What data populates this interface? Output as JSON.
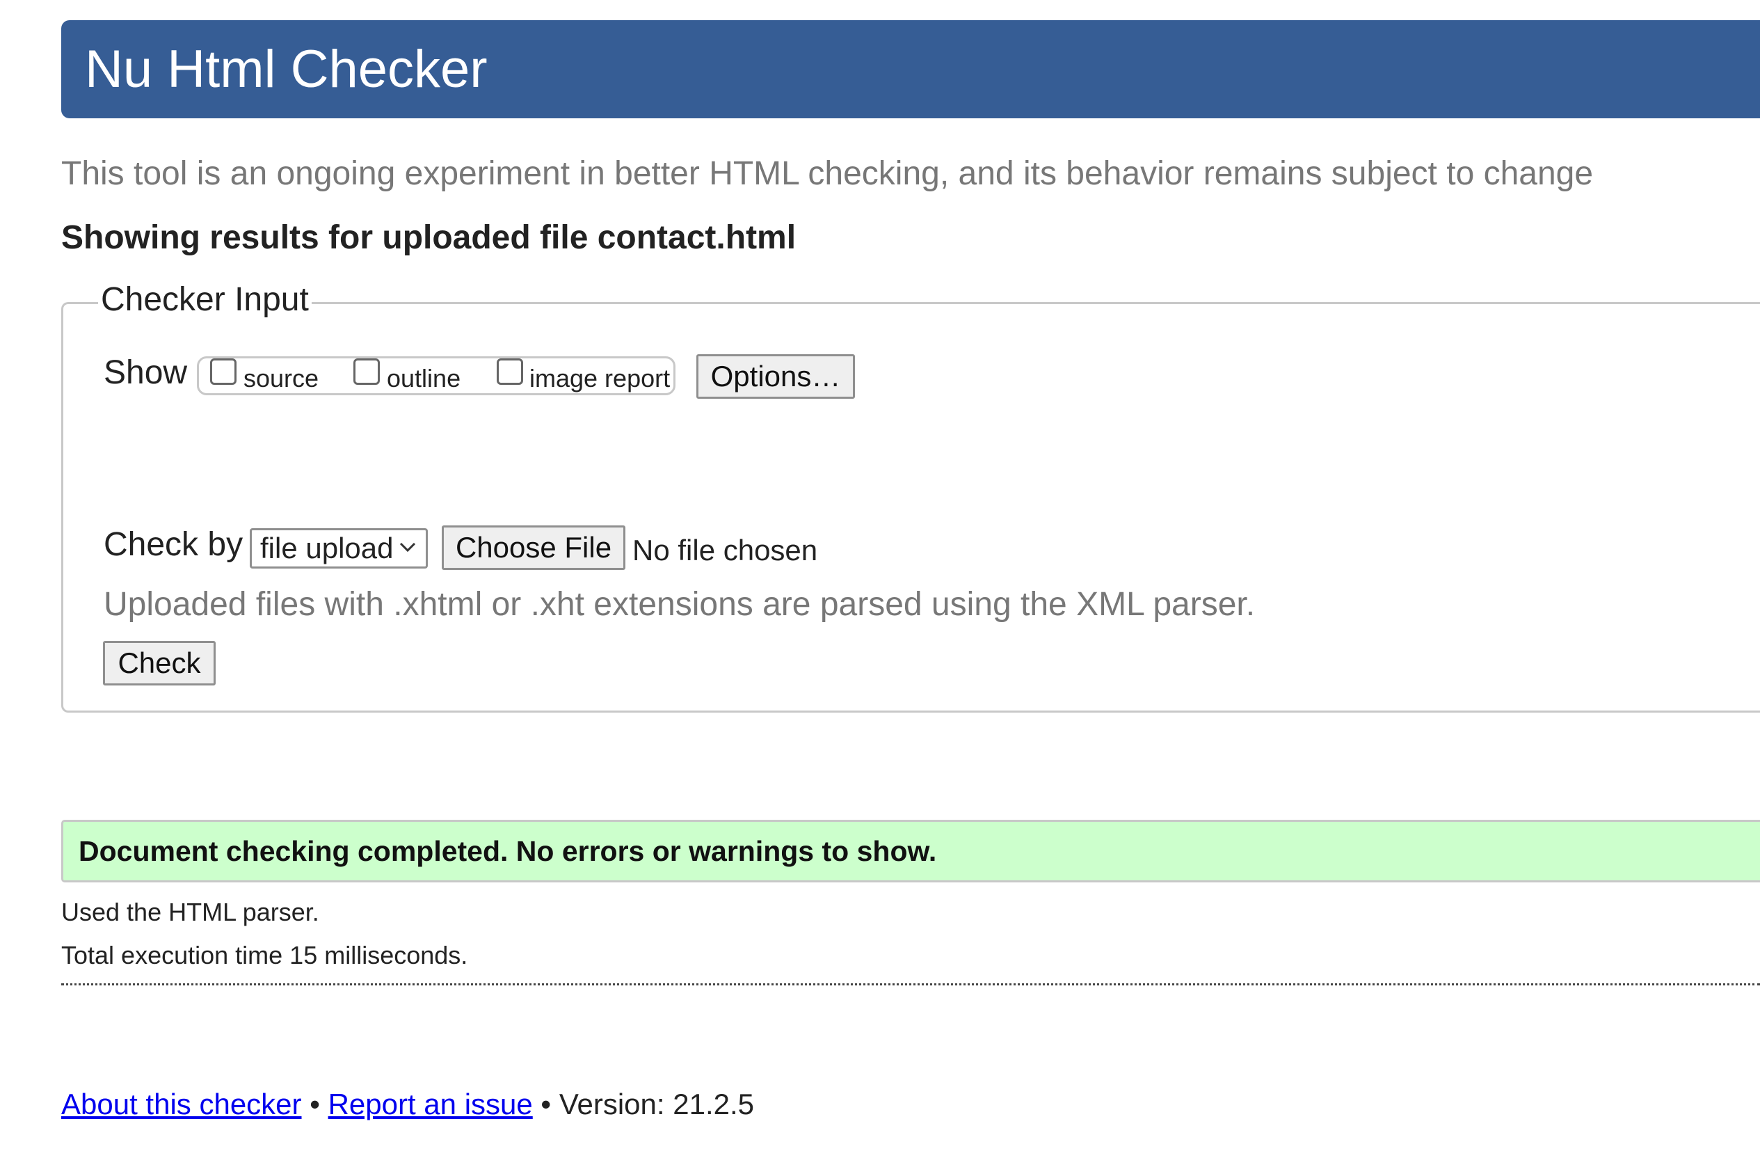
{
  "header": {
    "title": "Nu Html Checker"
  },
  "intro": "This tool is an ongoing experiment in better HTML checking, and its behavior remains subject to change",
  "results_heading": "Showing results for uploaded file contact.html",
  "checker_input": {
    "legend": "Checker Input",
    "show_label": "Show",
    "show_options": [
      {
        "label": "source",
        "checked": false
      },
      {
        "label": "outline",
        "checked": false
      },
      {
        "label": "image report",
        "checked": false
      }
    ],
    "options_button": "Options…",
    "check_by_label": "Check by",
    "check_by_value": "file upload",
    "choose_file_button": "Choose File",
    "no_file_text": "No file chosen",
    "upload_note": "Uploaded files with .xhtml or .xht extensions are parsed using the XML parser.",
    "check_button": "Check"
  },
  "result": {
    "success_message": "Document checking completed. No errors or warnings to show.",
    "success_color": "#ccffcc",
    "parser_note": "Used the HTML parser.",
    "execution_time": "Total execution time 15 milliseconds."
  },
  "footer": {
    "about_link": "About this checker",
    "separator": "•",
    "report_link": "Report an issue",
    "version": "Version: 21.2.5"
  },
  "colors": {
    "header_bg": "#365d95",
    "link": "#0000ee"
  }
}
